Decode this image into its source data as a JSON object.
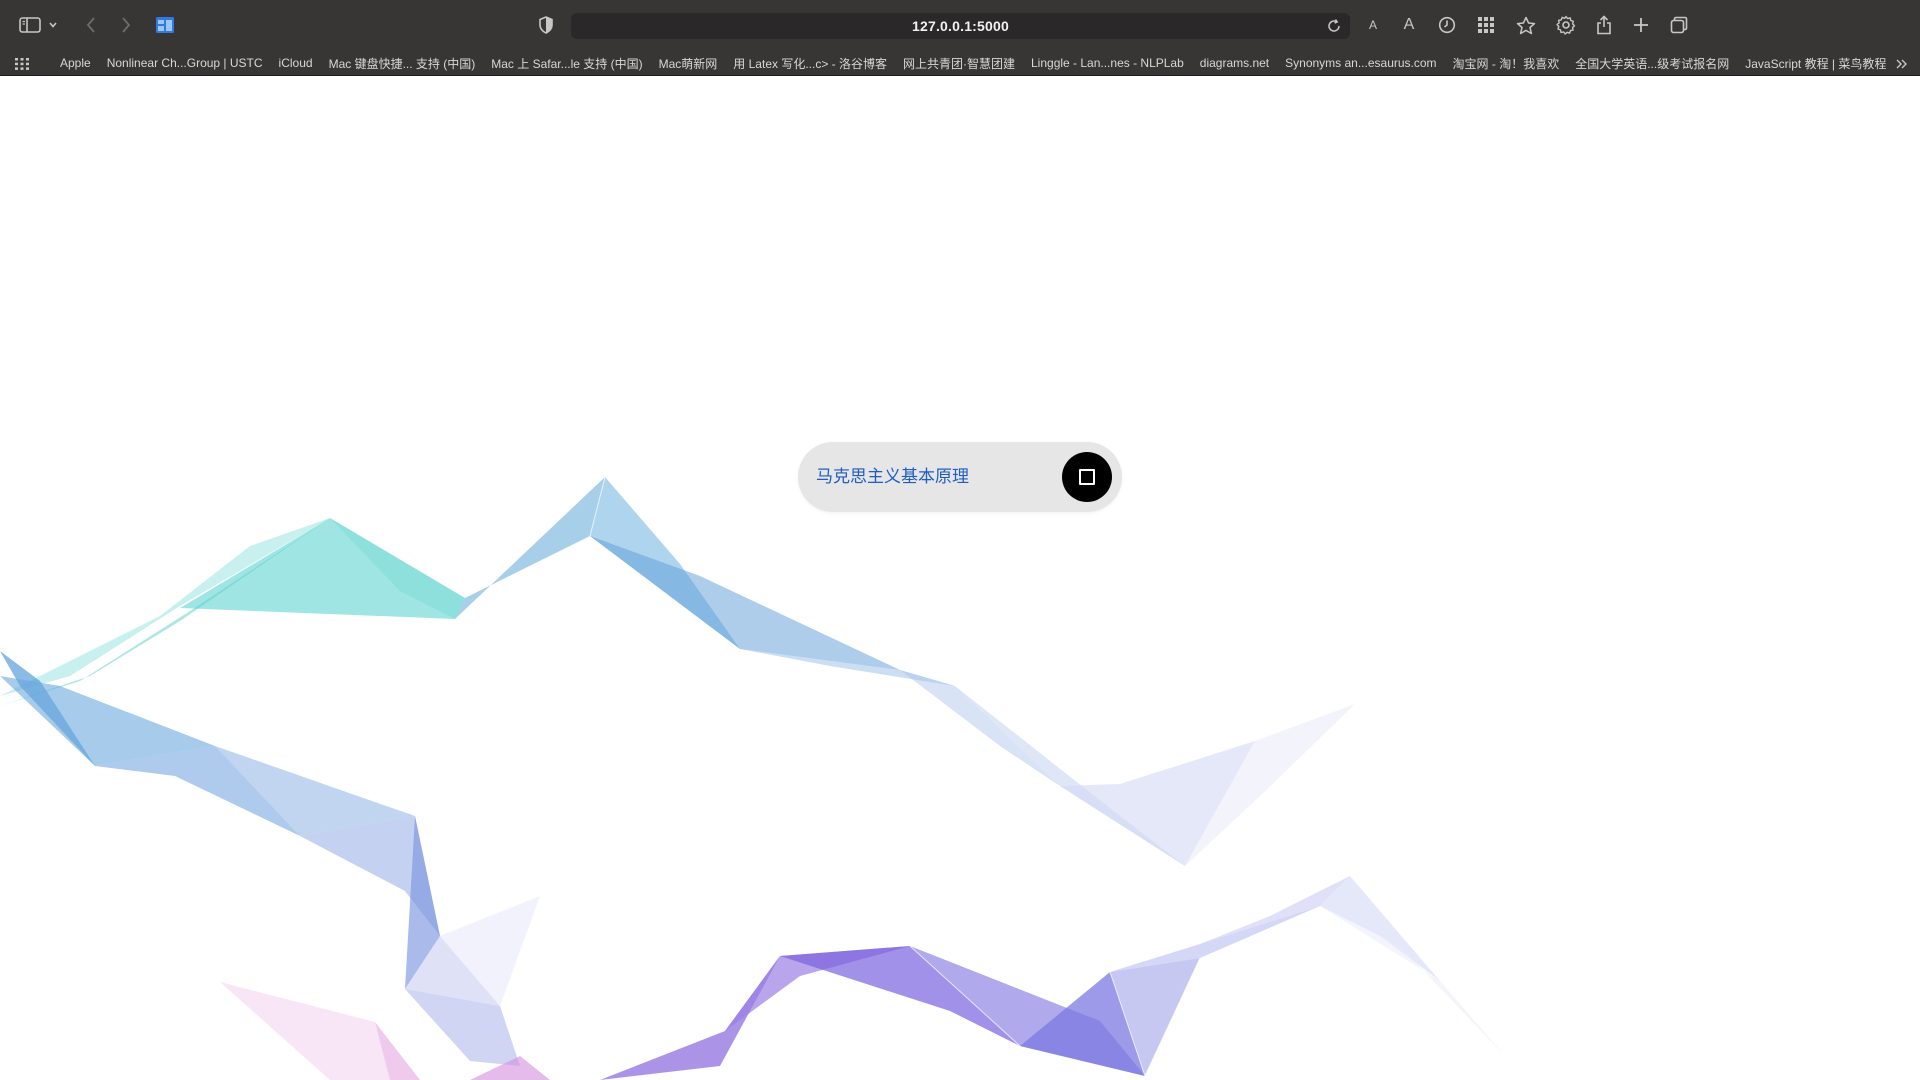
{
  "browser": {
    "url": "127.0.0.1:5000",
    "icons": {
      "sidebar": "sidebar-icon",
      "sidebar_menu": "chevron-down-icon",
      "back": "chevron-left-icon",
      "forward": "chevron-right-icon",
      "tab_overview": "tab-overview-icon",
      "privacy": "shield-icon",
      "reload": "reload-icon",
      "text_smaller": "text-smaller-icon",
      "text_larger": "text-larger-icon",
      "history": "clock-icon",
      "extensions": "grid-icon",
      "bookmark": "star-icon",
      "settings": "gear-icon",
      "share": "share-icon",
      "new_tab": "plus-icon",
      "tabs": "tabs-icon"
    },
    "text_small_label": "A",
    "text_large_label": "A",
    "bookmarks": [
      "Apple",
      "Nonlinear Ch...Group | USTC",
      "iCloud",
      "Mac 键盘快捷... 支持 (中国)",
      "Mac 上 Safar...le 支持 (中国)",
      "Mac萌新网",
      "用 Latex 写化...c> - 洛谷博客",
      "网上共青团·智慧团建",
      "Linggle - Lan...nes - NLPLab",
      "diagrams.net",
      "Synonyms an...esaurus.com",
      "淘宝网 - 淘！我喜欢",
      "全国大学英语...级考试报名网",
      "JavaScript 教程 | 菜鸟教程"
    ]
  },
  "page": {
    "search_value": "马克思主义基本原理",
    "stop_icon": "stop-icon"
  },
  "colors": {
    "chrome_bg": "#383535",
    "query_text": "#1f5cc4",
    "pill_bg": "#e6e6e6",
    "button_bg": "#000000",
    "ribbon_teal": "#5fd4d0",
    "ribbon_blue": "#6fa7dd",
    "ribbon_purple": "#7a5fe0",
    "ribbon_pink": "#f0c8ea"
  }
}
